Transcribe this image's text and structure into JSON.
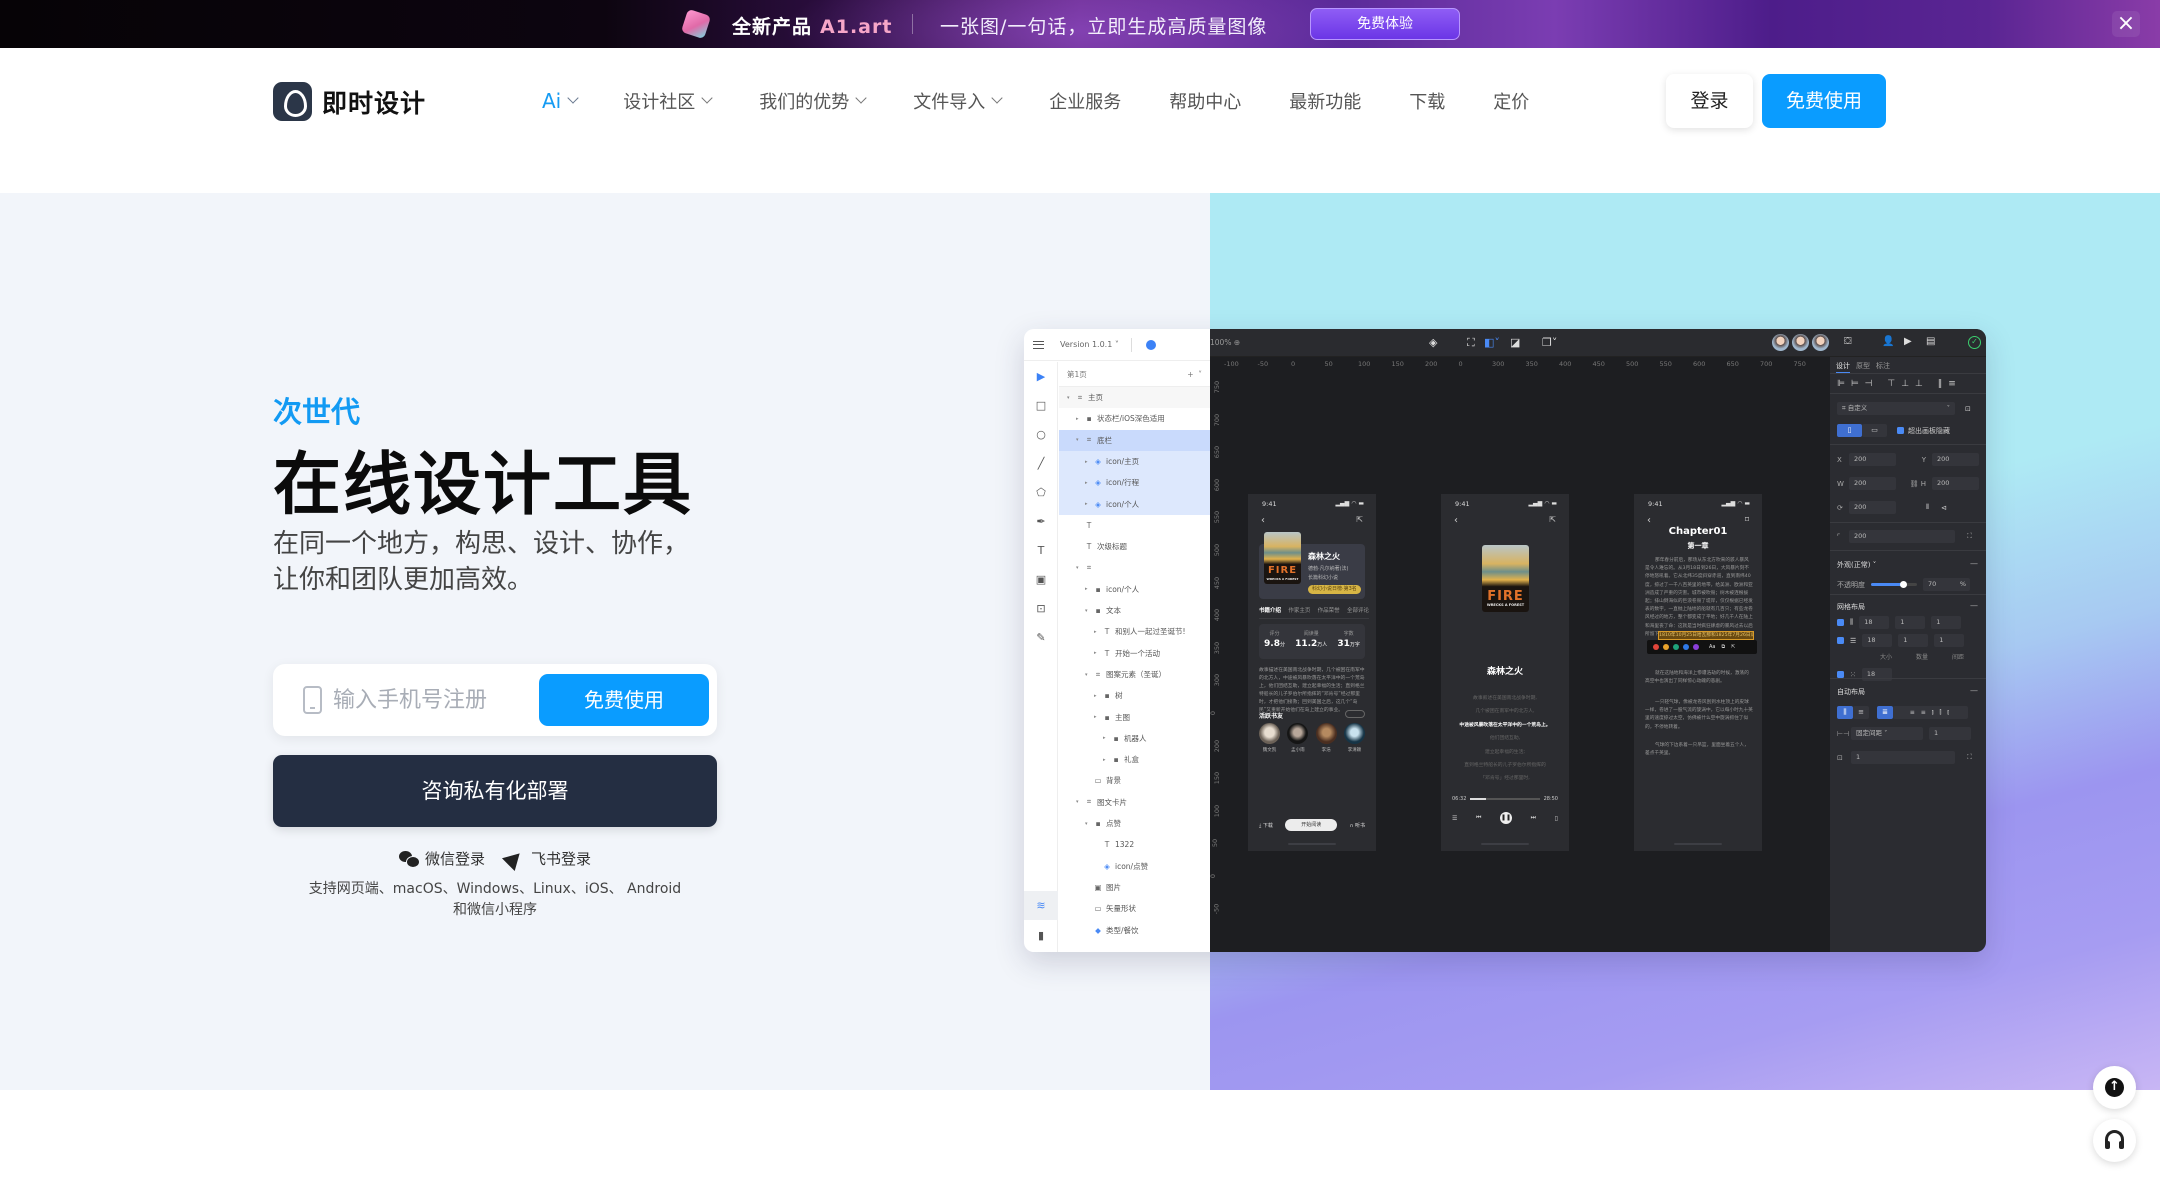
{
  "banner": {
    "product_label": "全新产品",
    "product_name": "A1.art",
    "tagline": "一张图/一句话，立即生成高质量图像",
    "cta": "免费体验",
    "colors": {
      "cta": "#7a45ee",
      "brand_text": "#f6a6c8"
    }
  },
  "header": {
    "logo_text": "即时设计",
    "menu": [
      {
        "label": "Ai",
        "dropdown": true
      },
      {
        "label": "设计社区",
        "dropdown": true
      },
      {
        "label": "我们的优势",
        "dropdown": true
      },
      {
        "label": "文件导入",
        "dropdown": true
      },
      {
        "label": "企业服务",
        "dropdown": false
      },
      {
        "label": "帮助中心",
        "dropdown": false
      },
      {
        "label": "最新功能",
        "dropdown": false
      },
      {
        "label": "下载",
        "dropdown": false
      },
      {
        "label": "定价",
        "dropdown": false
      }
    ],
    "login": "登录",
    "signup": "免费使用",
    "colors": {
      "accent": "#0a9cff",
      "ai": "#159bf3"
    }
  },
  "hero": {
    "eyebrow": "次世代",
    "title": "在线设计工具",
    "subtitle_line1": "在同一个地方，构思、设计、协作，",
    "subtitle_line2": "让你和团队更加高效。",
    "phone_placeholder": "输入手机号注册",
    "phone_value": "",
    "free_button": "免费使用",
    "private_button": "咨询私有化部署",
    "wechat_login": "微信登录",
    "feishu_login": "飞书登录",
    "platforms_line1": "支持网页端、macOS、Windows、Linux、iOS、 Android",
    "platforms_line2": "和微信小程序"
  },
  "mockup": {
    "version": "Version 1.0.1",
    "zoom": "100%",
    "page_label": "第1页",
    "layers": [
      {
        "label": "主页",
        "type": "frame",
        "indent": 0,
        "caret": "down",
        "state": "hover"
      },
      {
        "label": "状态栏/iOS深色适用",
        "type": "folder",
        "indent": 1,
        "caret": "right",
        "state": ""
      },
      {
        "label": "底栏",
        "type": "frame",
        "indent": 1,
        "caret": "down",
        "state": "selected"
      },
      {
        "label": "icon/主页",
        "type": "component",
        "indent": 2,
        "caret": "right",
        "state": "child-selected"
      },
      {
        "label": "icon/行程",
        "type": "component",
        "indent": 2,
        "caret": "right",
        "state": "child-selected"
      },
      {
        "label": "icon/个人",
        "type": "component",
        "indent": 2,
        "caret": "right",
        "state": "child-selected"
      },
      {
        "label": "",
        "type": "text",
        "indent": 1,
        "caret": "",
        "state": ""
      },
      {
        "label": "次级标题",
        "type": "text",
        "indent": 1,
        "caret": "",
        "state": ""
      },
      {
        "label": "",
        "type": "frame",
        "indent": 1,
        "caret": "down",
        "state": ""
      },
      {
        "label": "icon/个人",
        "type": "folder",
        "indent": 2,
        "caret": "right",
        "state": ""
      },
      {
        "label": "文本",
        "type": "folder",
        "indent": 2,
        "caret": "down",
        "state": ""
      },
      {
        "label": "和别人一起过圣诞节!",
        "type": "text",
        "indent": 3,
        "caret": "right",
        "state": ""
      },
      {
        "label": "开始一个活动",
        "type": "text",
        "indent": 3,
        "caret": "right",
        "state": ""
      },
      {
        "label": "图案元素（圣诞）",
        "type": "frame",
        "indent": 2,
        "caret": "down",
        "state": ""
      },
      {
        "label": "树",
        "type": "folder",
        "indent": 3,
        "caret": "right",
        "state": ""
      },
      {
        "label": "主图",
        "type": "folder",
        "indent": 3,
        "caret": "right",
        "state": ""
      },
      {
        "label": "机器人",
        "type": "folder",
        "indent": 4,
        "caret": "right",
        "state": ""
      },
      {
        "label": "礼盒",
        "type": "folder",
        "indent": 4,
        "caret": "right",
        "state": ""
      },
      {
        "label": "背景",
        "type": "rect",
        "indent": 2,
        "caret": "",
        "state": ""
      },
      {
        "label": "图文卡片",
        "type": "frame",
        "indent": 1,
        "caret": "down",
        "state": ""
      },
      {
        "label": "点赞",
        "type": "folder",
        "indent": 2,
        "caret": "down",
        "state": ""
      },
      {
        "label": "1322",
        "type": "text",
        "indent": 3,
        "caret": "",
        "state": ""
      },
      {
        "label": "icon/点赞",
        "type": "component",
        "indent": 3,
        "caret": "",
        "state": ""
      },
      {
        "label": "图片",
        "type": "image",
        "indent": 2,
        "caret": "",
        "state": ""
      },
      {
        "label": "矢量形状",
        "type": "rect",
        "indent": 2,
        "caret": "",
        "state": ""
      },
      {
        "label": "类型/餐饮",
        "type": "instance",
        "indent": 2,
        "caret": "",
        "state": ""
      }
    ],
    "ruler_h": [
      "-100",
      "-50",
      "0",
      "50",
      "100",
      "150",
      "200",
      "0",
      "300",
      "350",
      "400",
      "450",
      "500",
      "550",
      "600",
      "650",
      "700",
      "750"
    ],
    "ruler_v": [
      "750",
      "700",
      "650",
      "600",
      "550",
      "500",
      "450",
      "400",
      "350",
      "300",
      "0",
      "200",
      "150",
      "100",
      "50",
      "0",
      "-50"
    ],
    "screen1": {
      "time": "9:41",
      "book_title": "森林之火",
      "author": "德勃·凡尔纳著(法)",
      "genre": "长篇科幻小说",
      "tag": "科幻小说日榜·第3名",
      "cover_title": "FIRE",
      "cover_subtitle": "WRECKS A FOREST",
      "tabs": [
        "书籍介绍",
        "作家主页",
        "作品荣誉",
        "全部评论"
      ],
      "stats": [
        {
          "label": "评分",
          "value": "9.8",
          "unit": "分"
        },
        {
          "label": "阅读量",
          "value": "11.2",
          "unit": "万人"
        },
        {
          "label": "字数",
          "value": "31",
          "unit": "万字"
        }
      ],
      "description": "故事描述在美国南北战争时期，几个被困在南军中的北方人，中途被风暴吹落在太平洋中的一个荒岛上，他们团结互助，建立起幸福的生活；直到格兰特船长的儿子罗伯尔所指挥的“邓肯号”经过那里时，才把他们接救；回到美国之后，这几个“岛民”又重新开始他们在岛上建立的事业。",
      "friends_title": "活跃书友",
      "friends_more": "查看全部",
      "friends": [
        "魏文凯",
        "孟小雨",
        "李浩",
        "李清颖"
      ],
      "download": "下载",
      "read": "开始阅读",
      "listen": "听书"
    },
    "screen2": {
      "time": "9:41",
      "title": "森林之火",
      "lyrics": [
        "故事叙述在美国南北战争时期,",
        "几个被困在南军中的北方人,",
        "中途被风暴吹落在太平洋中的一个荒岛上。",
        "他们团结互助,",
        "建立起幸福的生活;",
        "直到格兰特船长的儿子罗伯尔所指挥的",
        "「邓肯号」经过那里时,"
      ],
      "current_line": 2,
      "elapsed": "06:32",
      "total": "28:50",
      "progress": 0.23
    },
    "screen3": {
      "time": "9:41",
      "chapter": "Chapter01",
      "chapter_cn": "第一章",
      "para1": "那年春分前后，那场从东北方吹来的骇人暴风是令人难忘的。从3月18日到26日，大风暴片刻不停地怒吼着。它从北纬35度斜穿赤道，直到南纬40度，掠过了一千八百英里的地带，给美洲、欧洲和亚洲造成了严重的灾害。城市被吹毁；树木被连根拔起；排山倒海似的巨浪卷毁了堤岸，仅仅根据已经发表的数字，一直抛上陆地的船就有几百只；有些龙卷风经过的地方，整个都变成了平地；好几千人在陆上和海里丧了命：这就是当时疯狂肆虐的暴风过去以后所留下的痕迹。",
      "highlight": "1810年10月25日哈瓦那和1825年7月26日瓜德罗",
      "para2": "就在这陆地和海洋上惨遭浩劫的时候，激荡的高空中也演出了同样惊心动魄的悲剧。",
      "para3": "一只轻气球，像被龙卷风刮到水柱顶上的皮球一样，卷进了一股气流的旋涡中，它以每小时九十英里的速度掠过太空，仿佛被什么空中旋涡抓住了似的，不停地转着。",
      "para4": "气球的下边系着一只吊篮，里面坐着五个人，差点千英里。",
      "palette": [
        "#e0453a",
        "#e9a32c",
        "#1fa37a",
        "#2f78e6",
        "#8a3ed9"
      ],
      "font_label": "Aa"
    },
    "props": {
      "tabs": [
        "设计",
        "原型",
        "标注"
      ],
      "frame_preset": "自定义",
      "clip_content_label": "超出画板隐藏",
      "clip_content": true,
      "x": "200",
      "y": "200",
      "w": "200",
      "h": "200",
      "rotation": "200",
      "radius": "200",
      "appearance_label": "外观(正常)",
      "opacity_label": "不透明度",
      "opacity": 70,
      "opacity_unit": "%",
      "grid_title": "网格布局",
      "grids": [
        {
          "enabled": true,
          "size": "18",
          "count": "1",
          "gap": "1"
        },
        {
          "enabled": true,
          "size": "18",
          "count": "1",
          "gap": "1"
        },
        {
          "enabled": true,
          "size": "18"
        }
      ],
      "grid_col_labels": [
        "大小",
        "数量",
        "间距"
      ],
      "auto_layout_title": "自动布局",
      "spacing_mode": "固定间距",
      "spacing_value": "1",
      "padding_value": "1"
    }
  }
}
